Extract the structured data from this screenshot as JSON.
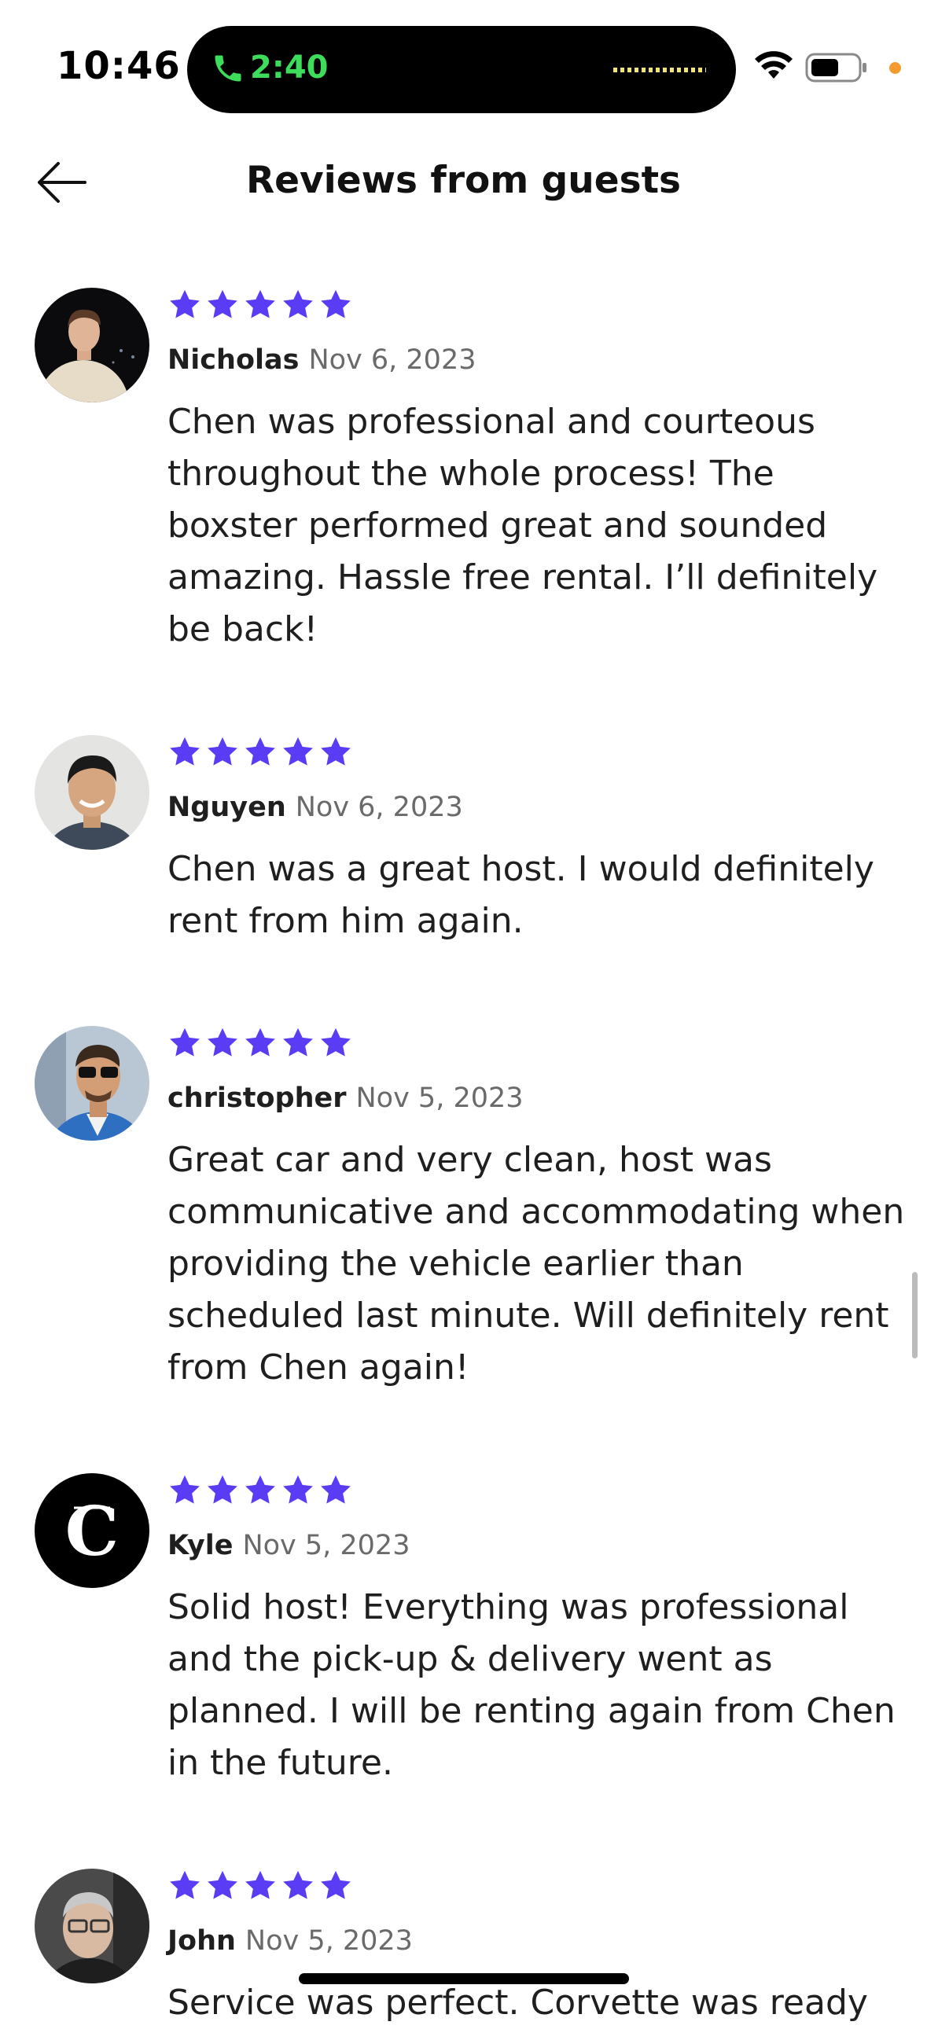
{
  "status_bar": {
    "time": "10:46",
    "call_timer": "2:40",
    "icons": [
      "phone-icon",
      "wifi-icon",
      "battery-icon"
    ],
    "call_color": "#3ddc5a",
    "privacy_dot_color": "#f39b2e"
  },
  "header": {
    "title": "Reviews from guests",
    "back_icon": "arrow-left-icon"
  },
  "accent_star_color": "#5b3cf5",
  "reviews": [
    {
      "name": "Nicholas",
      "date": "Nov 6, 2023",
      "rating": 5,
      "text": "Chen was professional and courteous throughout the whole process! The boxster performed great and sounded amazing. Hassle free rental. I’ll definitely be back!"
    },
    {
      "name": "Nguyen",
      "date": "Nov 6, 2023",
      "rating": 5,
      "text": "Chen was a great host. I would definitely rent from him again."
    },
    {
      "name": "christopher",
      "date": "Nov 5, 2023",
      "rating": 5,
      "text": "Great car and very clean, host was communicative and accommodating when providing the vehicle earlier than scheduled last minute. Will definitely rent from Chen again!"
    },
    {
      "name": "Kyle",
      "date": "Nov 5, 2023",
      "rating": 5,
      "text": "Solid host!  Everything was professional and the pick-up & delivery went as planned.  I will be renting again from Chen in the future."
    },
    {
      "name": "John",
      "date": "Nov 5, 2023",
      "rating": 5,
      "text": "Service was perfect. Corvette was ready"
    }
  ]
}
